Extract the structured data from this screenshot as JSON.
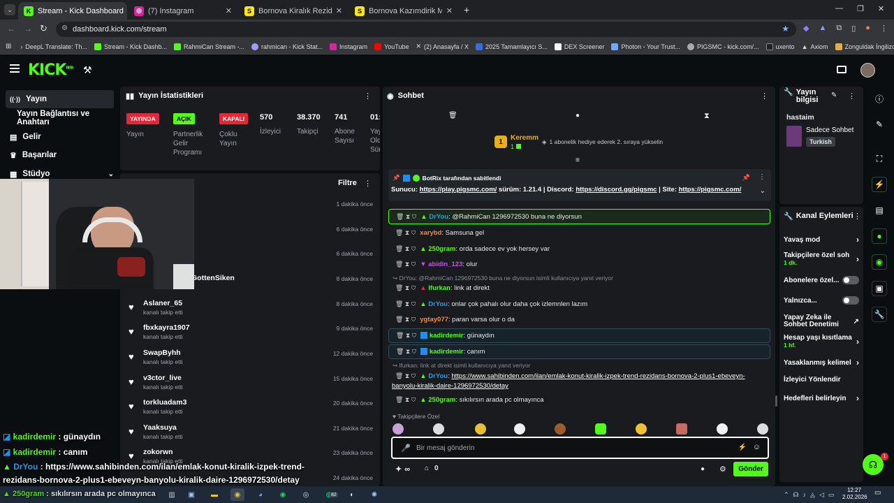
{
  "browser": {
    "tabs": [
      {
        "title": "Stream - Kick Dashboard",
        "active": true
      },
      {
        "title": "(7) Instagram"
      },
      {
        "title": "Bornova Kiralık Rezidans Fiyatla"
      },
      {
        "title": "Bornova Kazımdirik Mah. Metro"
      }
    ],
    "url": "dashboard.kick.com/stream",
    "bookmarks": [
      "DeepL Translate: Th...",
      "Stream - Kick Dashb...",
      "RahmiCan Stream -...",
      "rahmican - Kick Stat...",
      "Instagram",
      "YouTube",
      "(2) Anasayfa / X",
      "2025 Tamamlayıcı S...",
      "DEX Screener",
      "Photon - Your Trust...",
      "PIGSMC - kick.com/...",
      "uxento",
      "Axiom",
      "Zonguldak İngilizce..."
    ]
  },
  "kick": {
    "logo": "KICK",
    "logo_beta": "BETA",
    "sidebar": {
      "items": [
        {
          "label": "Yayın"
        },
        {
          "label": "Yayın Bağlantısı ve Anahtarı"
        },
        {
          "label": "Gelir"
        },
        {
          "label": "Başarılar"
        },
        {
          "label": "Stüdyo"
        }
      ]
    },
    "stats": {
      "title": "Yayın İstatistikleri",
      "badges": [
        {
          "badge": "YAYINDA",
          "label": "Yayın"
        },
        {
          "badge": "AÇIK",
          "label": "Partnerlik Gelir Programı"
        },
        {
          "badge": "KAPALI",
          "label": "Çoklu Yayın"
        }
      ],
      "numbers": [
        {
          "value": "570",
          "label": "İzleyici"
        },
        {
          "value": "38.370",
          "label": "Takipçi"
        },
        {
          "value": "741",
          "label": "Abone Sayısı"
        },
        {
          "value": "01:",
          "label": "Yay Old Sür"
        }
      ]
    },
    "activity": {
      "filter": "Filtre",
      "rows": [
        {
          "name": "",
          "sub": "",
          "time": "1 dakika önce"
        },
        {
          "name": "",
          "sub": "",
          "time": "6 dakika önce"
        },
        {
          "name": "",
          "sub": "",
          "time": "6 dakika önce"
        },
        {
          "name": "GottenSiken",
          "sub": "",
          "time": "8 dakika önce"
        },
        {
          "name": "Aslaner_65",
          "sub": "kanalı takip etti",
          "time": "8 dakika önce"
        },
        {
          "name": "fbxkayra1907",
          "sub": "kanalı takip etti",
          "time": "9 dakika önce"
        },
        {
          "name": "SwapByhh",
          "sub": "kanalı takip etti",
          "time": "12 dakika önce"
        },
        {
          "name": "v3ctor_live",
          "sub": "kanalı takip etti",
          "time": "15 dakika önce"
        },
        {
          "name": "torkluadam3",
          "sub": "kanalı takip etti",
          "time": "20 dakika önce"
        },
        {
          "name": "Yaaksuya",
          "sub": "kanalı takip etti",
          "time": "21 dakika önce"
        },
        {
          "name": "zokorwn",
          "sub": "kanalı takip etti",
          "time": "23 dakika önce"
        },
        {
          "name": "",
          "sub": "",
          "time": "24 dakika önce"
        }
      ]
    },
    "chat": {
      "title": "Sohbet",
      "top_gifter": {
        "name": "Keremm",
        "count": "1",
        "rank": "1",
        "message": "1 abonelik hediye ederek 2. sıraya yükselin"
      },
      "pinned": {
        "by": "BotRix tarafından sabitlendi",
        "prefix1": "Sunucu: ",
        "link1": "https://play.pigsmc.com/",
        "mid1": " sürüm: 1.21.4 | Discord: ",
        "link2": "https://discord.gg/pigsmc",
        "mid2": " | Site: ",
        "link3": "https://pigsmc.com/"
      },
      "messages": [
        {
          "user": "DrYou",
          "text": "@RahmiCan 1296972530 buna ne diyorsun"
        },
        {
          "user": "xarybd",
          "text": "Samsuna gel"
        },
        {
          "user": "250gram",
          "text": "orda sadece ev yok hersey var"
        },
        {
          "user": "abidin_123",
          "text": "olur"
        },
        {
          "user": "lfurkan",
          "text": "link at direkt"
        },
        {
          "user": "DrYou",
          "text": "onlar çok pahalı olur daha çok izlemnlen lazım"
        },
        {
          "user": "ygtay077",
          "text": "paran varsa olur o da"
        },
        {
          "user": "kadirdemir",
          "text": "günaydın"
        },
        {
          "user": "kadirdemir",
          "text": "canım"
        },
        {
          "user": "DrYou",
          "text_link": "https://www.sahibinden.com/ilan/emlak-konut-kiralik-izpek-trend-rezidans-bornova-2-plus1-ebeveyn-",
          "text_link2": "banyolu-kiralik-daire-1296972530/detay"
        },
        {
          "user": "250gram",
          "text": "sıkılırsın arada pc olmayınca"
        }
      ],
      "replies": [
        "DrYou: @RahmiCan 1296972530 buna ne diyorsun isimli kullanıcıya yanıt veriyor",
        "lfurkan: link at direkt isimli kullanıcıya yanıt veriyor"
      ],
      "followers_only": "Takipçilere Özel",
      "input_placeholder": "Bir mesaj gönderin",
      "infinity": "∞",
      "count": "0",
      "send": "Gönder"
    },
    "stream_info": {
      "title": "Yayın bilgisi",
      "name": "hastaim",
      "category": "Sadece Sohbet",
      "language": "Turkish"
    },
    "channel_actions": {
      "title": "Kanal Eylemleri",
      "items": [
        {
          "label": "Yavaş mod"
        },
        {
          "label": "Takipçilere özel soh",
          "sub": "1 dk."
        },
        {
          "label": "Abonelere özel..."
        },
        {
          "label": "Yalnızca..."
        },
        {
          "label": "Yapay Zeka ile Sohbet Denetimi"
        },
        {
          "label": "Hesap yaşı kısıtlama",
          "sub": "1 hf."
        },
        {
          "label": "Yasaklanmış kelimel"
        },
        {
          "label": "İzleyici Yönlendir"
        },
        {
          "label": "Hedefleri belirleyin"
        }
      ]
    },
    "notif_count": "1"
  },
  "overlay": {
    "lines": [
      {
        "user": "kadirdemir",
        "text": " : günaydın"
      },
      {
        "user": "kadirdemir",
        "text": " : canım"
      },
      {
        "user": "DrYou",
        "text": " : https://www.sahibinden.com/ilan/emlak-konut-kiralik-izpek-trend-"
      },
      {
        "user": "",
        "text": "rezidans-bornova-2-plus1-ebeveyn-banyolu-kiralik-daire-1296972530/detay"
      },
      {
        "user": "250gram",
        "text": " : sıkılırsın arada pc olmayınca"
      }
    ]
  },
  "taskbar": {
    "time": "12:27",
    "date": "2.02.2026",
    "whatsapp_badge": "82"
  },
  "colors": {
    "kick_green": "#53fc18",
    "live_red": "#e8263a",
    "panel": "#191b1f"
  }
}
